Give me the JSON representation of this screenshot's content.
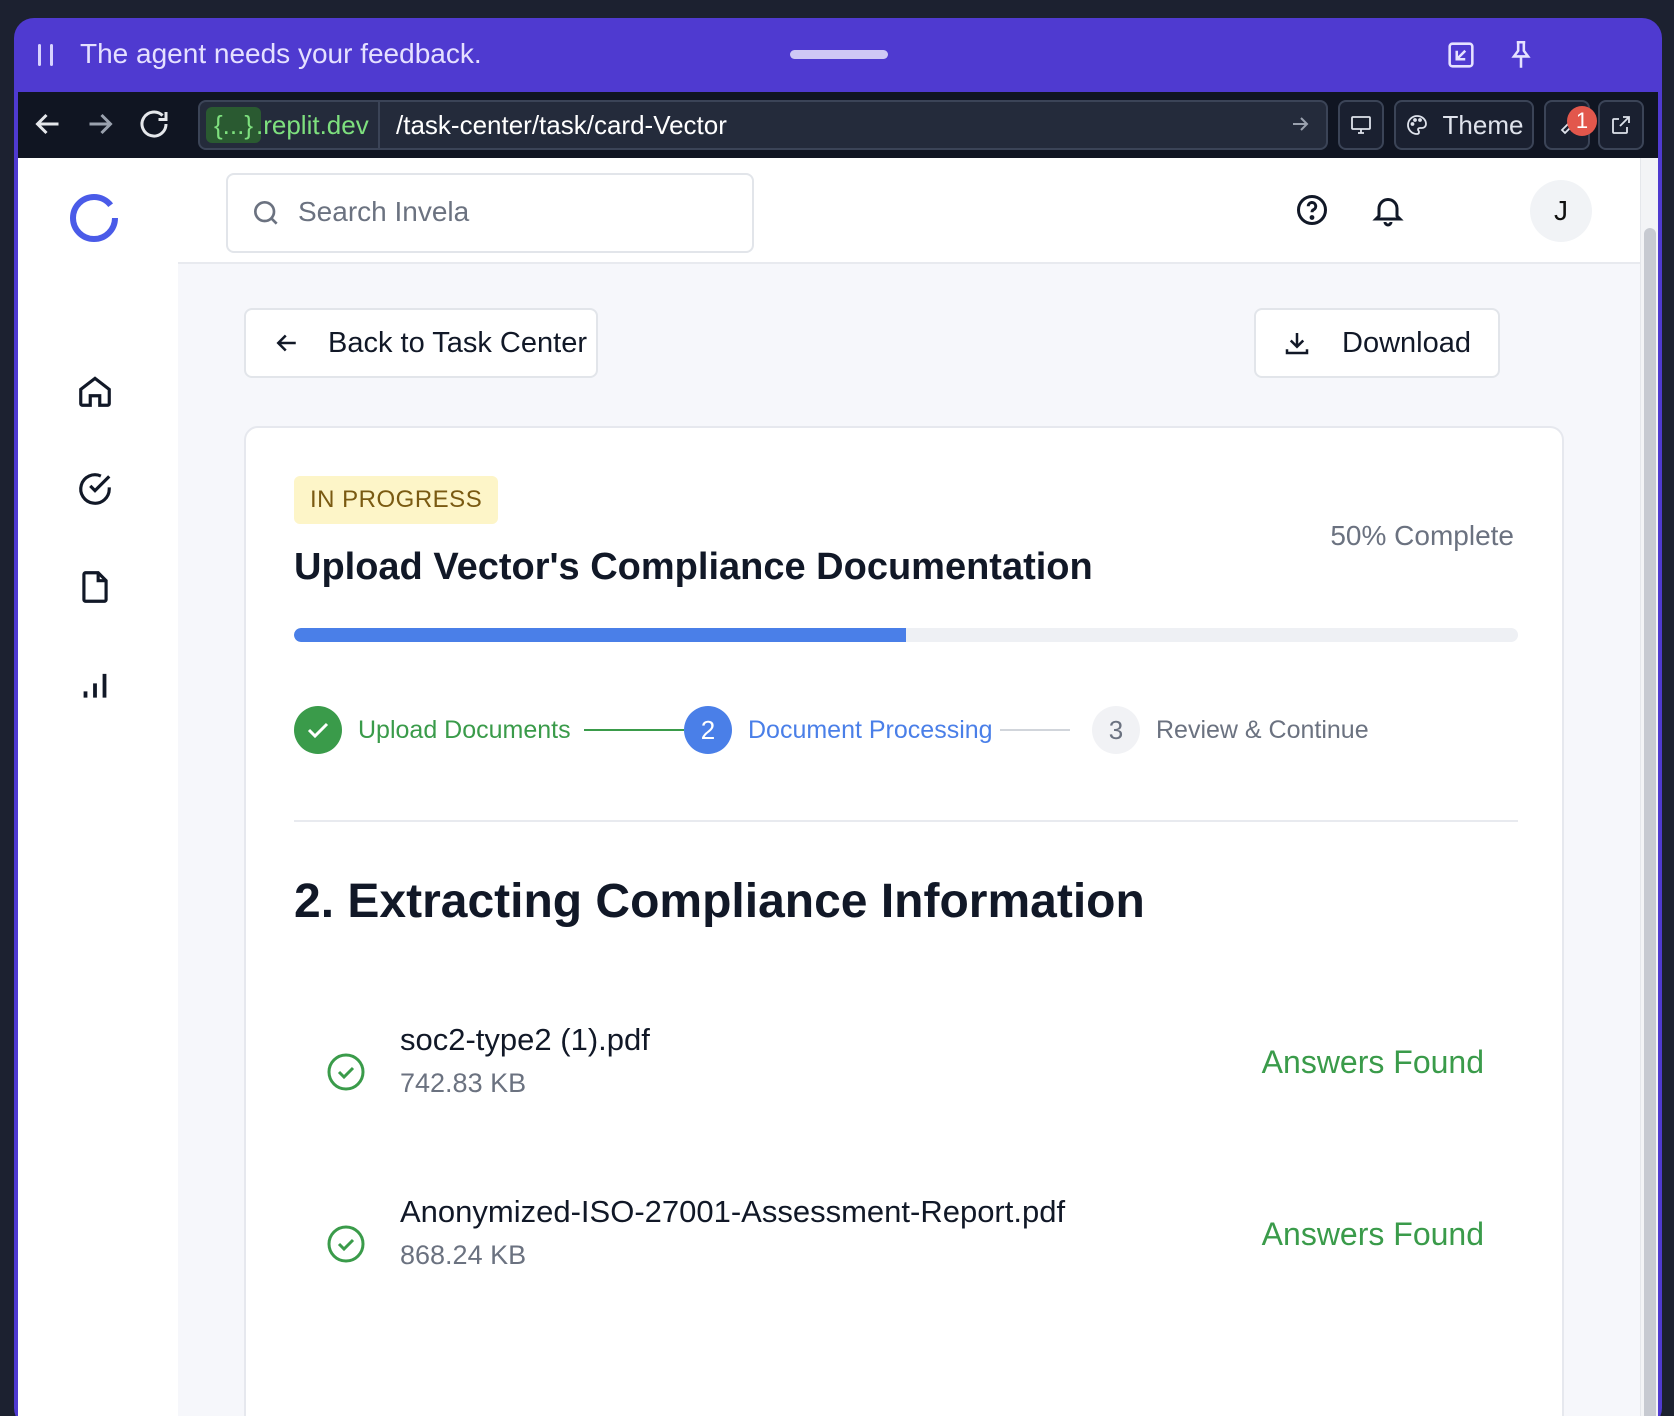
{
  "agent_bar": {
    "message": "The agent needs your feedback."
  },
  "browser": {
    "host_prefix": "{...}",
    "host_domain": ".replit.dev",
    "path": "/task-center/task/card-Vector",
    "theme_label": "Theme",
    "notification_count": "1"
  },
  "header": {
    "search_placeholder": "Search Invela",
    "avatar_initial": "J"
  },
  "toolbar": {
    "back_label": "Back to Task Center",
    "download_label": "Download"
  },
  "task": {
    "status": "IN PROGRESS",
    "title": "Upload Vector's Compliance Documentation",
    "percent_label": "50% Complete",
    "progress": 0.5,
    "steps": [
      {
        "number": "1",
        "label": "Upload Documents",
        "state": "complete"
      },
      {
        "number": "2",
        "label": "Document Processing",
        "state": "active"
      },
      {
        "number": "3",
        "label": "Review & Continue",
        "state": "pending"
      }
    ]
  },
  "section": {
    "title": "2. Extracting Compliance Information",
    "files": [
      {
        "name": "soc2-type2 (1).pdf",
        "size": "742.83 KB",
        "status": "Answers Found"
      },
      {
        "name": "Anonymized-ISO-27001-Assessment-Report.pdf",
        "size": "868.24 KB",
        "status": "Answers Found"
      }
    ]
  },
  "colors": {
    "agent_bar": "#4f3ad0",
    "accent_blue": "#4a7fe8",
    "success_green": "#3a9b4a",
    "status_badge_bg": "#fdf5c8"
  },
  "icons": {
    "sidebar": [
      "home-icon",
      "tasks-check-icon",
      "file-icon",
      "analytics-icon"
    ],
    "header": [
      "help-icon",
      "bell-icon"
    ]
  }
}
